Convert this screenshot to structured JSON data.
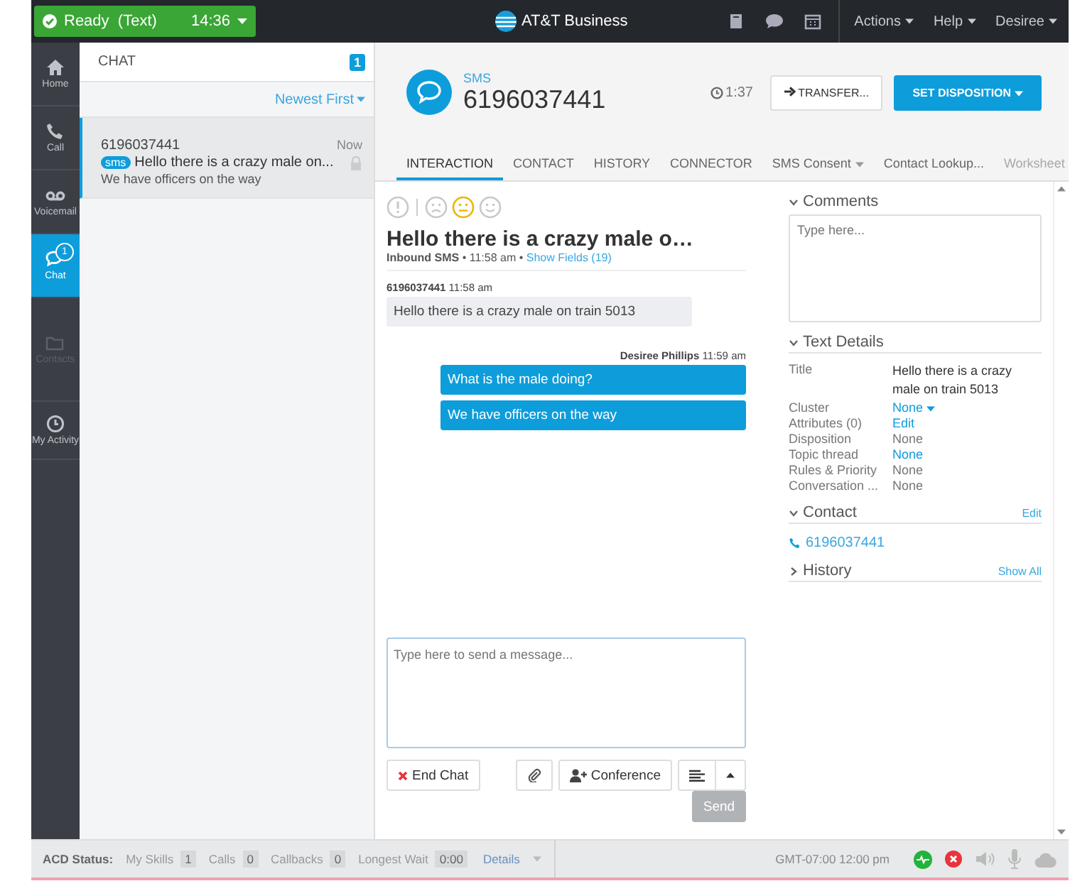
{
  "status_button": {
    "state": "Ready",
    "mode": "(Text)",
    "time": "14:36"
  },
  "brand": "AT&T Business",
  "top_menu": [
    "Actions",
    "Help",
    "Desiree"
  ],
  "nav": [
    {
      "label": "Home",
      "selected": false,
      "disabled": false
    },
    {
      "label": "Call",
      "selected": false,
      "disabled": false
    },
    {
      "label": "Voicemail",
      "selected": false,
      "disabled": false
    },
    {
      "label": "Chat",
      "selected": true,
      "disabled": false,
      "badge": "1"
    },
    {
      "label": "Contacts",
      "selected": false,
      "disabled": true
    },
    {
      "label": "My Activity",
      "selected": false,
      "disabled": false
    }
  ],
  "chat_list": {
    "title": "CHAT",
    "count": "1",
    "sort": "Newest First",
    "items": [
      {
        "number": "6196037441",
        "time": "Now",
        "tag": "sms",
        "preview": "Hello there is a crazy male on...",
        "last": "We have officers on the way",
        "selected": true
      }
    ]
  },
  "interaction": {
    "channel": "SMS",
    "number": "6196037441",
    "timer": "1:37",
    "transfer": "TRANSFER...",
    "disposition": "SET DISPOSITION"
  },
  "tabs": [
    {
      "label": "INTERACTION",
      "selected": true,
      "disabled": false,
      "dropdown": false
    },
    {
      "label": "CONTACT",
      "selected": false,
      "disabled": false,
      "dropdown": false
    },
    {
      "label": "HISTORY",
      "selected": false,
      "disabled": false,
      "dropdown": false
    },
    {
      "label": "CONNECTOR",
      "selected": false,
      "disabled": false,
      "dropdown": false
    },
    {
      "label": "SMS Consent",
      "selected": false,
      "disabled": false,
      "dropdown": true
    },
    {
      "label": "Contact Lookup...",
      "selected": false,
      "disabled": false,
      "dropdown": false
    },
    {
      "label": "Worksheet",
      "selected": false,
      "disabled": true,
      "dropdown": false
    }
  ],
  "sentiments": [
    {
      "kind": "urgent",
      "selected": false
    },
    {
      "kind": "sad",
      "selected": false
    },
    {
      "kind": "neutral",
      "selected": true
    },
    {
      "kind": "happy",
      "selected": false
    }
  ],
  "conversation": {
    "title": "Hello there is a crazy male o…",
    "meta": "**Inbound SMS** • 11:58 am •",
    "link": "Show Fields (19)",
    "messages": [
      {
        "kind": "inbound",
        "sender": "6196037441",
        "time": "11:58 am",
        "text": "Hello there is a crazy male on train 5013"
      },
      {
        "kind": "outbound",
        "sender": "Desiree Phillips",
        "time": "11:59 am",
        "text": "What is the male doing?"
      },
      {
        "kind": "outbound",
        "text": "We have officers on the way"
      }
    ]
  },
  "composer": {
    "placeholder": "Type here to send a message...",
    "end_chat": "End Chat",
    "conference": "Conference",
    "send": "Send",
    "send_disabled": true
  },
  "side": {
    "comments": {
      "title": "Comments",
      "expanded": true,
      "placeholder": "Type here..."
    },
    "text_details": {
      "title": "Text Details",
      "expanded": true,
      "rows": [
        {
          "label": "Title",
          "value": "Hello there is a crazy male on train 5013",
          "kind": "text"
        },
        {
          "label": "Cluster",
          "value": "None",
          "kind": "dropdown"
        },
        {
          "label": "Attributes (0)",
          "value": "Edit",
          "kind": "link"
        },
        {
          "label": "Disposition",
          "value": "None",
          "kind": "plain"
        },
        {
          "label": "Topic thread",
          "value": "None",
          "kind": "link"
        },
        {
          "label": "Rules & Priority",
          "value": "None",
          "kind": "plain"
        },
        {
          "label": "Conversation ...",
          "value": "None",
          "kind": "plain"
        }
      ]
    },
    "contact": {
      "title": "Contact",
      "expanded": true,
      "action": "Edit",
      "phone": "6196037441"
    },
    "history": {
      "title": "History",
      "expanded": false,
      "action": "Show All"
    }
  },
  "status_bar": {
    "label": "ACD Status:",
    "stats": [
      {
        "label": "My Skills",
        "value": "1"
      },
      {
        "label": "Calls",
        "value": "0"
      },
      {
        "label": "Callbacks",
        "value": "0"
      },
      {
        "label": "Longest Wait",
        "value": "0:00"
      }
    ],
    "details": "Details",
    "clock": "GMT-07:00 12:00 pm"
  }
}
